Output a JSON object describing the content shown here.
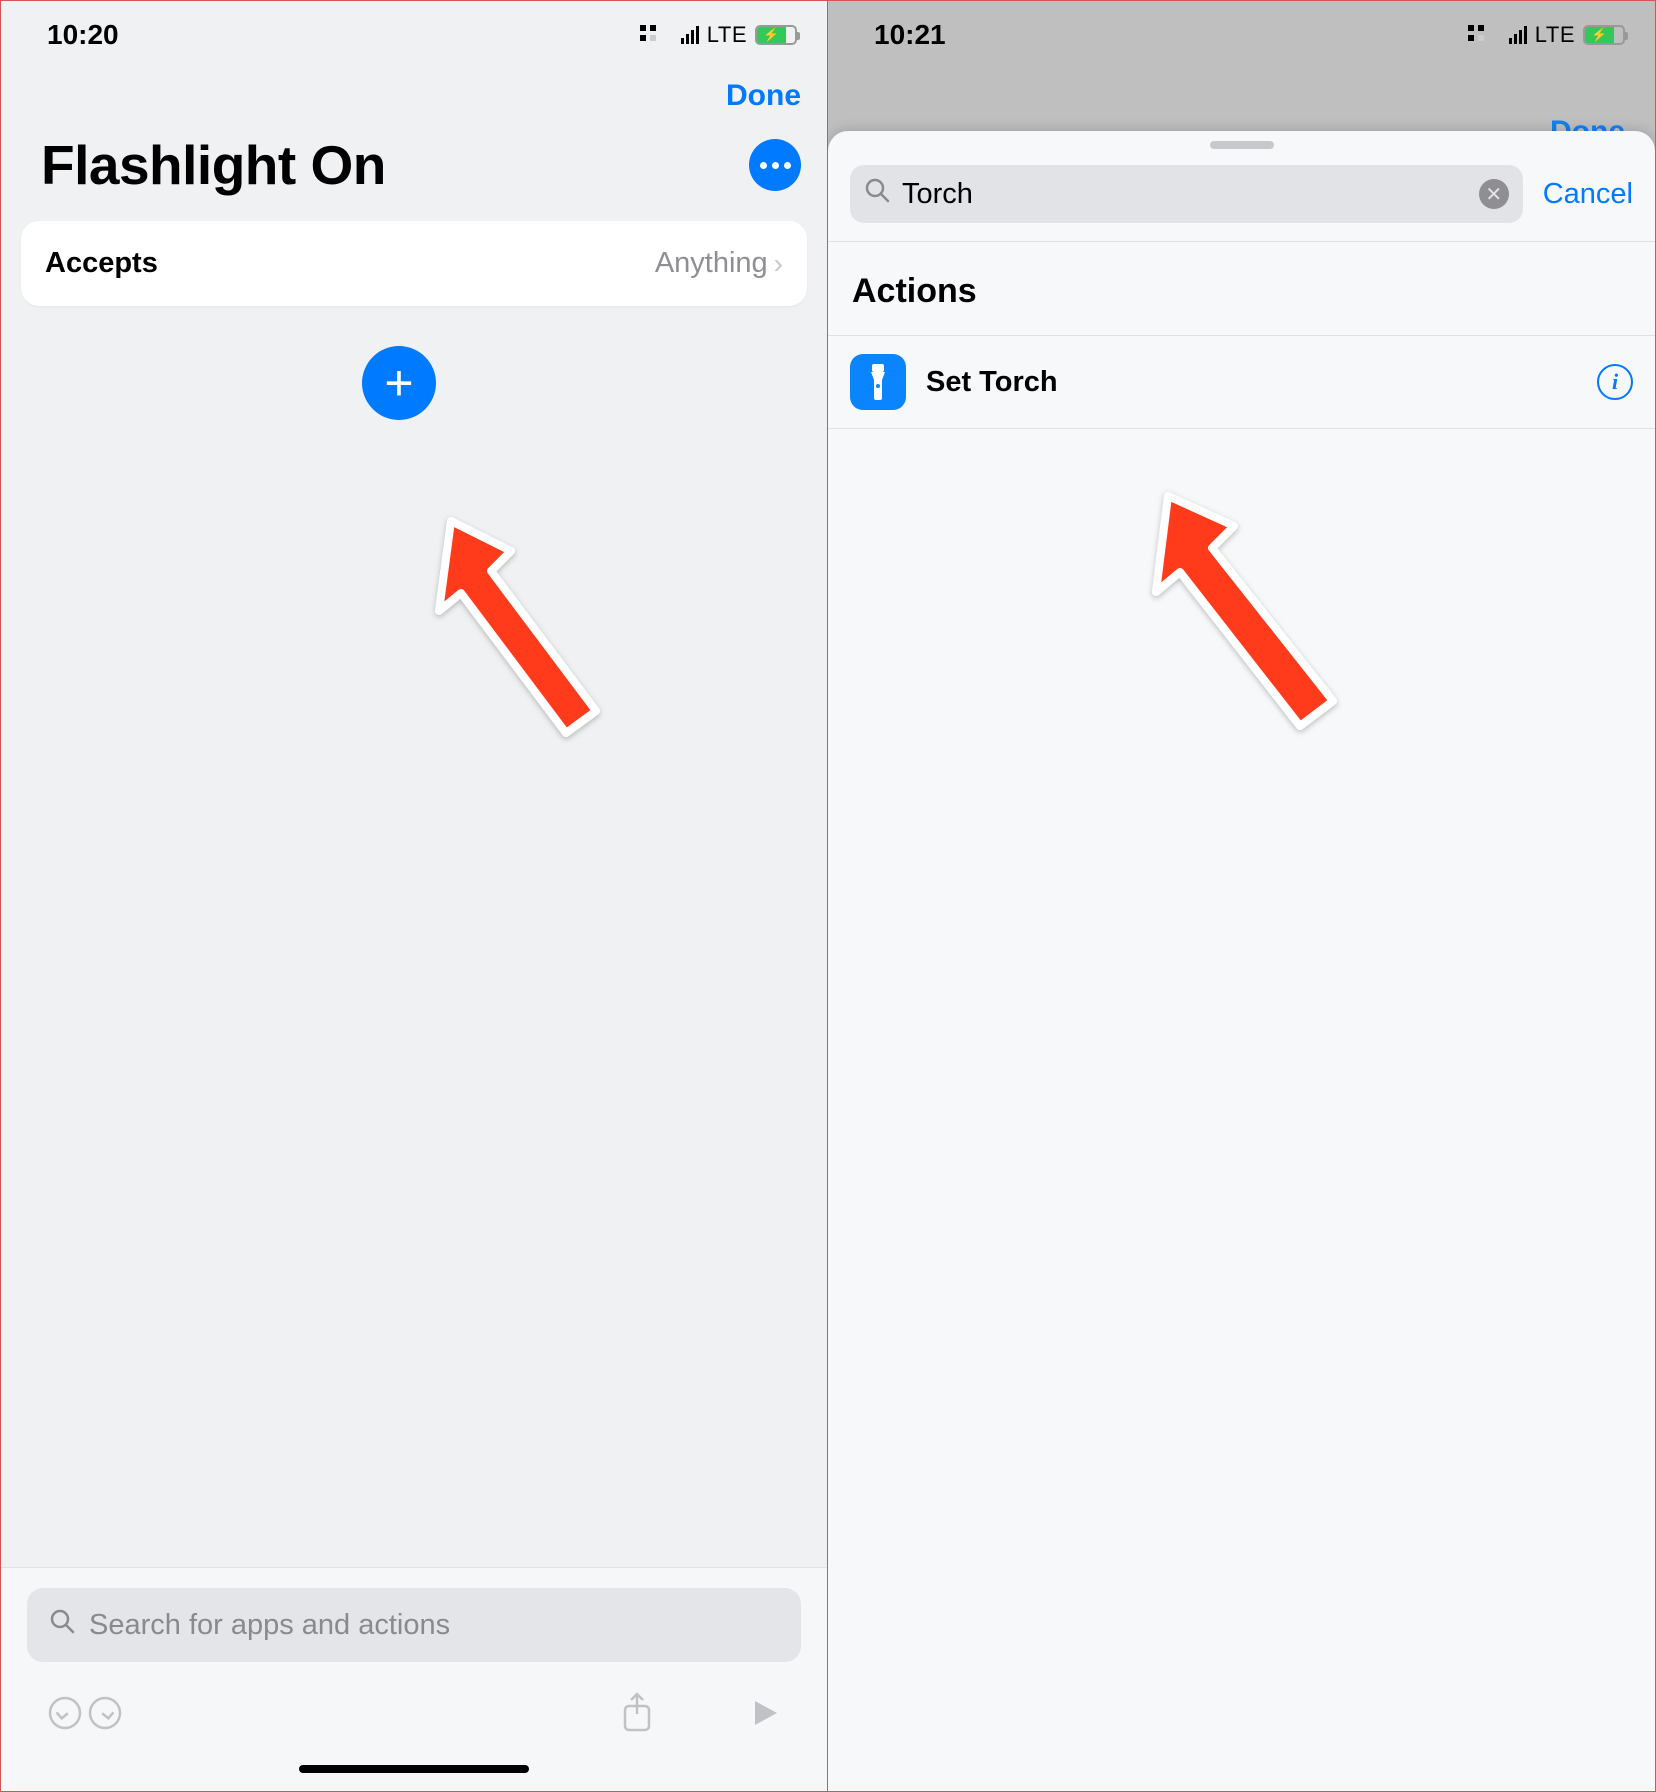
{
  "left": {
    "status": {
      "time": "10:20",
      "network": "LTE"
    },
    "nav": {
      "done": "Done"
    },
    "title": "Flashlight On",
    "card": {
      "label": "Accepts",
      "value": "Anything"
    },
    "search_placeholder": "Search for apps and actions"
  },
  "right": {
    "status": {
      "time": "10:21",
      "network": "LTE"
    },
    "done_behind": "Done",
    "sheet": {
      "search_value": "Torch",
      "cancel": "Cancel",
      "section_title": "Actions",
      "action": {
        "label": "Set Torch"
      }
    }
  }
}
